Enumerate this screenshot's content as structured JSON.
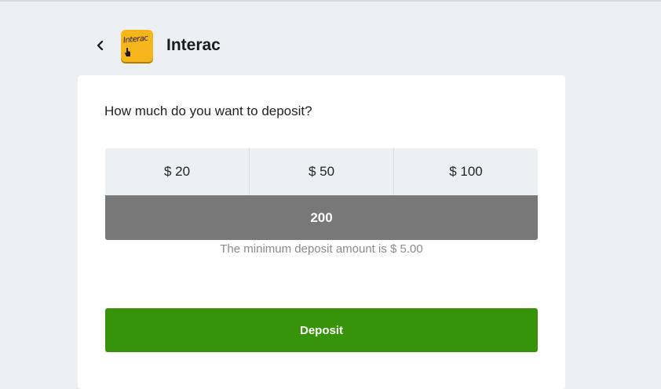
{
  "header": {
    "back_icon": "chevron-left-icon",
    "logo_icon": "interac-logo-icon",
    "logo_text": "Interac",
    "title": "Interac"
  },
  "deposit_form": {
    "question": "How much do you want to deposit?",
    "presets": [
      "$ 20",
      "$ 50",
      "$ 100"
    ],
    "amount_value": "200",
    "min_note": "The minimum deposit amount is $ 5.00",
    "submit_label": "Deposit"
  },
  "colors": {
    "background": "#edf0f3",
    "logo_yellow": "#f7b51c",
    "input_gray": "#787878",
    "deposit_green": "#37940a"
  }
}
